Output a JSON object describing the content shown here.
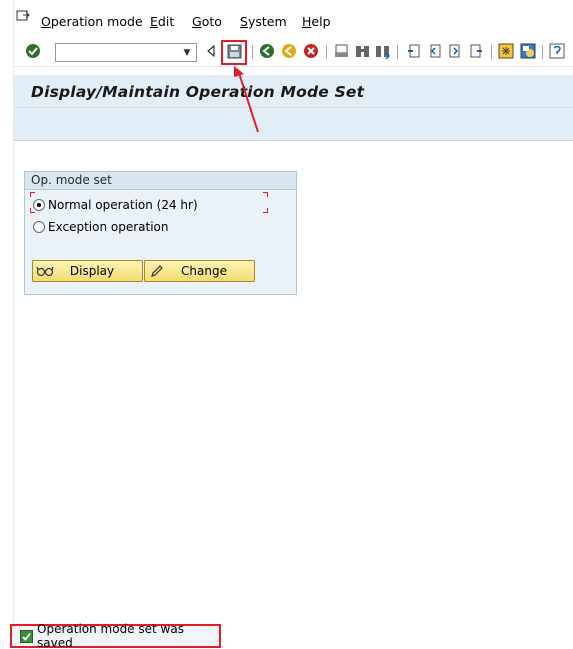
{
  "menubar": {
    "items": [
      {
        "label": "Operation mode"
      },
      {
        "label": "Edit"
      },
      {
        "label": "Goto"
      },
      {
        "label": "System"
      },
      {
        "label": "Help"
      }
    ]
  },
  "toolbar": {
    "command_field_value": "",
    "icons": [
      "enter-check-icon",
      "back-triangle-icon",
      "save-icon",
      "back-icon",
      "exit-icon",
      "cancel-icon",
      "print-icon",
      "find-icon",
      "find-next-icon",
      "first-page-icon",
      "prev-page-icon",
      "next-page-icon",
      "last-page-icon",
      "new-session-icon",
      "shortcut-icon"
    ]
  },
  "title": "Display/Maintain Operation Mode Set",
  "group": {
    "title": "Op. mode set",
    "options": [
      {
        "label": "Normal operation (24 hr)",
        "selected": true
      },
      {
        "label": "Exception operation",
        "selected": false
      }
    ],
    "buttons": {
      "display": "Display",
      "change": "Change"
    }
  },
  "status": {
    "message": "Operation mode set was saved"
  },
  "colors": {
    "highlight": "#e31d25",
    "title_area": "#e3edf6",
    "button": "#f4dc72"
  }
}
